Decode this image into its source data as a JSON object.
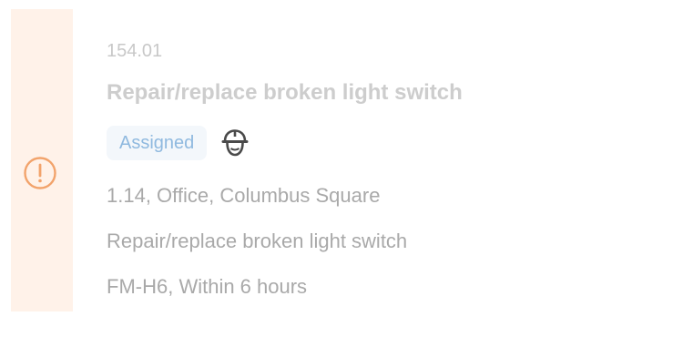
{
  "ticket": {
    "id": "154.01",
    "title": "Repair/replace broken light switch",
    "status": "Assigned",
    "location": "1.14, Office, Columbus Square",
    "description": "Repair/replace broken light switch",
    "sla": "FM-H6, Within 6 hours"
  },
  "icons": {
    "priority": "exclamation-circle-icon",
    "assignee": "hard-hat-worker-icon"
  },
  "colors": {
    "priority_strip": "#fff2e9",
    "priority_icon": "#f2a36b",
    "status_text": "#8fb9df",
    "status_bg": "#f3f7fb",
    "muted_text": "#a9a9a9"
  }
}
